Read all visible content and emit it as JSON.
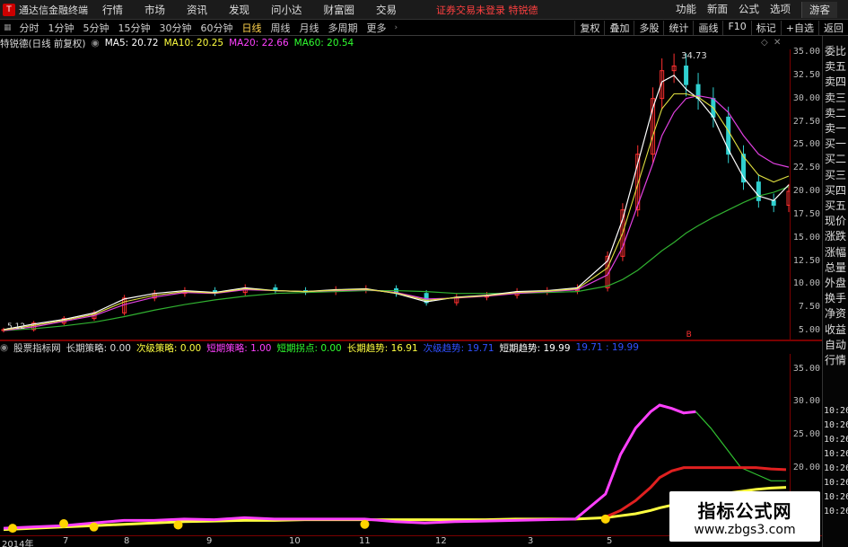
{
  "titlebar": {
    "app_name": "通达信金融终端",
    "menus": [
      "行情",
      "市场",
      "资讯",
      "发现",
      "问小达",
      "财富圈",
      "交易"
    ],
    "alert": "证券交易未登录 特锐德",
    "right_menus": [
      "功能",
      "新面",
      "公式",
      "选项"
    ],
    "guest": "游客"
  },
  "periodbar": {
    "periods": [
      "分时",
      "1分钟",
      "5分钟",
      "15分钟",
      "30分钟",
      "60分钟",
      "日线",
      "周线",
      "月线",
      "多周期",
      "更多"
    ],
    "active": "日线",
    "tools": [
      "复权",
      "叠加",
      "多股",
      "统计",
      "画线",
      "F10",
      "标记",
      "+自选",
      "返回"
    ]
  },
  "main_legend": {
    "stock": "特锐德(日线 前复权)",
    "ma5": "MA5: 20.72",
    "ma10": "MA10: 20.25",
    "ma20": "MA20: 22.66",
    "ma60": "MA60: 20.54",
    "colors": {
      "ma5": "#ffffff",
      "ma10": "#ffff40",
      "ma20": "#ff40ff",
      "ma60": "#30c030"
    }
  },
  "ind_legend": {
    "name": "股票指标网",
    "items": [
      {
        "text": "长期策略: 0.00",
        "color": "#dddddd"
      },
      {
        "text": "次级策略: 0.00",
        "color": "#ffff40"
      },
      {
        "text": "短期策略: 1.00",
        "color": "#ff40ff"
      },
      {
        "text": "短期拐点: 0.00",
        "color": "#30ff30"
      },
      {
        "text": "长期趋势: 16.91",
        "color": "#ffff40"
      },
      {
        "text": "次级趋势: 19.71",
        "color": "#3050ff"
      },
      {
        "text": "短期趋势: 19.99",
        "color": "#ffffff"
      },
      {
        "text": "19.71 : 19.99",
        "color": "#3050ff"
      }
    ]
  },
  "price_axis": [
    "35.00",
    "32.50",
    "30.00",
    "27.50",
    "25.00",
    "22.50",
    "20.00",
    "17.50",
    "15.00",
    "12.50",
    "10.00",
    "7.50",
    "5.00"
  ],
  "ind_axis": [
    "35.00",
    "30.00",
    "25.00",
    "20.00",
    "15.00"
  ],
  "annotations": {
    "high": "34.73",
    "low": "5.12",
    "marker": "B"
  },
  "side_items": [
    "委比",
    "卖五",
    "卖四",
    "卖三",
    "卖二",
    "卖一",
    "买一",
    "买二",
    "买三",
    "买四",
    "买五",
    "现价",
    "涨跌",
    "涨幅",
    "总量",
    "外盘",
    "换手",
    "净资",
    "收益",
    "自动",
    "行情"
  ],
  "side_times": [
    "10:26",
    "10:26",
    "10:26",
    "10:26",
    "10:26",
    "10:26",
    "10:26",
    "10:26"
  ],
  "time_axis": [
    "2014年",
    "7",
    "8",
    "9",
    "10",
    "11",
    "12",
    "3",
    "5"
  ],
  "watermark": {
    "title": "指标公式网",
    "url": "www.zbgs3.com"
  },
  "chart_data": {
    "type": "line",
    "title": "特锐德(日线 前复权)",
    "ylim": [
      5,
      35
    ],
    "x": [
      0,
      10,
      20,
      30,
      40,
      50,
      60,
      70,
      80,
      90,
      100,
      110,
      120,
      130,
      140,
      150,
      160,
      170,
      180,
      190,
      200,
      205,
      210,
      215,
      218,
      222,
      226,
      230,
      235,
      240,
      245,
      250,
      255,
      260
    ],
    "series": [
      {
        "name": "Close",
        "values": [
          5.1,
          5.8,
          6.3,
          6.9,
          8.5,
          9.0,
          9.3,
          9.1,
          9.6,
          9.3,
          9.2,
          9.4,
          9.5,
          9.0,
          8.0,
          8.6,
          8.8,
          9.2,
          9.3,
          9.6,
          13.0,
          18.0,
          24.0,
          30.0,
          33.0,
          33.5,
          31.5,
          30.0,
          28.0,
          24.0,
          21.0,
          19.0,
          18.5,
          20.0
        ]
      },
      {
        "name": "MA60",
        "values": [
          5.0,
          5.2,
          5.5,
          5.9,
          6.5,
          7.2,
          7.8,
          8.3,
          8.7,
          9.0,
          9.1,
          9.2,
          9.3,
          9.3,
          9.2,
          9.0,
          9.0,
          9.0,
          9.1,
          9.2,
          9.8,
          10.5,
          11.5,
          12.8,
          13.6,
          14.5,
          15.5,
          16.3,
          17.2,
          18.0,
          18.8,
          19.5,
          19.9,
          20.5
        ]
      },
      {
        "name": "MA20",
        "values": [
          5.0,
          5.4,
          6.0,
          6.6,
          7.8,
          8.6,
          9.1,
          9.0,
          9.4,
          9.3,
          9.2,
          9.3,
          9.4,
          9.1,
          8.4,
          8.5,
          8.7,
          9.0,
          9.2,
          9.4,
          11.0,
          14.0,
          18.5,
          23.0,
          26.0,
          28.5,
          30.0,
          30.3,
          30.0,
          28.5,
          26.0,
          24.0,
          23.0,
          22.6
        ]
      },
      {
        "name": "MA5",
        "values": [
          5.1,
          5.7,
          6.2,
          6.9,
          8.4,
          9.0,
          9.3,
          9.1,
          9.6,
          9.3,
          9.2,
          9.4,
          9.5,
          9.0,
          8.1,
          8.6,
          8.8,
          9.2,
          9.3,
          9.6,
          12.5,
          17.0,
          23.0,
          29.0,
          31.8,
          32.5,
          31.0,
          30.0,
          28.0,
          24.5,
          21.5,
          19.5,
          19.0,
          20.7
        ]
      }
    ]
  },
  "ind_chart_data": {
    "type": "line",
    "ylim": [
      10,
      37
    ],
    "x": [
      0,
      10,
      20,
      30,
      40,
      50,
      60,
      70,
      80,
      90,
      100,
      110,
      120,
      130,
      140,
      150,
      160,
      170,
      180,
      190,
      200,
      205,
      210,
      215,
      218,
      222,
      226,
      230,
      235,
      240,
      245,
      250,
      255,
      260
    ],
    "series": [
      {
        "name": "长期趋势",
        "color": "#ffff40",
        "values": [
          10.6,
          10.8,
          11.0,
          11.2,
          11.4,
          11.6,
          11.8,
          11.9,
          12.0,
          12.0,
          12.1,
          12.1,
          12.1,
          12.1,
          12.1,
          12.1,
          12.1,
          12.2,
          12.2,
          12.2,
          12.4,
          12.7,
          13.0,
          13.5,
          13.9,
          14.3,
          14.8,
          15.2,
          15.7,
          16.1,
          16.4,
          16.7,
          16.9,
          17.0
        ]
      },
      {
        "name": "短期策略",
        "color": "#ff40ff",
        "values": [
          10.8,
          11.0,
          11.2,
          11.6,
          12.0,
          12.0,
          12.2,
          12.1,
          12.4,
          12.2,
          12.2,
          12.2,
          12.2,
          11.8,
          11.6,
          11.8,
          11.9,
          12.0,
          12.1,
          12.2,
          16.0,
          22.0,
          26.0,
          28.5,
          29.5,
          29.0,
          28.3,
          28.5,
          null,
          null,
          null,
          null,
          null,
          null
        ]
      },
      {
        "name": "短期拐点",
        "color": "#30c030",
        "values": [
          null,
          null,
          null,
          null,
          null,
          null,
          null,
          null,
          null,
          null,
          null,
          null,
          null,
          null,
          null,
          null,
          null,
          null,
          null,
          null,
          null,
          null,
          null,
          null,
          null,
          null,
          null,
          28.5,
          26.0,
          23.0,
          20.0,
          19.0,
          18.0,
          18.0
        ]
      },
      {
        "name": "次级趋势",
        "color": "#e02020",
        "values": [
          null,
          null,
          null,
          null,
          null,
          null,
          null,
          null,
          null,
          null,
          null,
          null,
          null,
          null,
          null,
          null,
          null,
          null,
          null,
          null,
          12.5,
          13.5,
          15.0,
          17.0,
          18.5,
          19.5,
          20.0,
          20.0,
          20.0,
          20.0,
          20.0,
          20.0,
          19.8,
          19.7
        ]
      }
    ]
  }
}
